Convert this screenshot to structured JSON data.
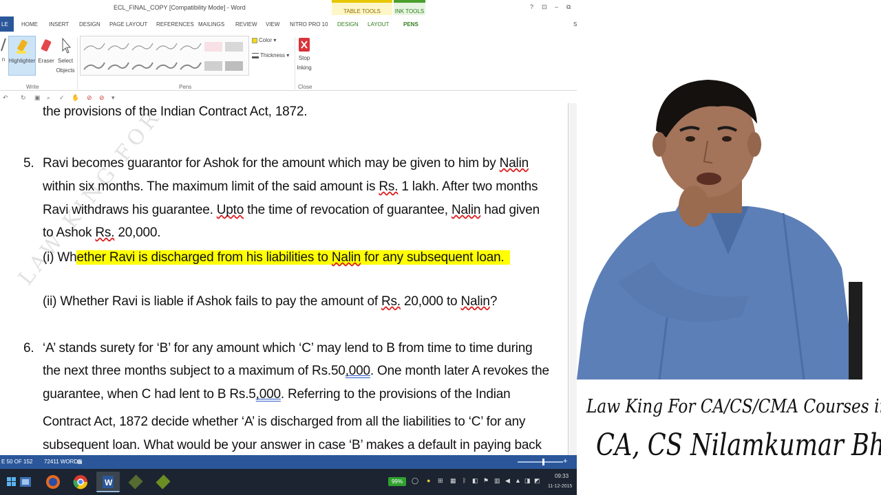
{
  "window": {
    "title": "ECL_FINAL_COPY [Compatibility Mode] - Word",
    "context_tabs": [
      "TABLE TOOLS",
      "INK TOOLS"
    ],
    "controls": [
      "?",
      "⊡",
      "–",
      "⧉"
    ]
  },
  "menu": {
    "file": "LE",
    "items": [
      "HOME",
      "INSERT",
      "DESIGN",
      "PAGE LAYOUT",
      "REFERENCES",
      "MAILINGS",
      "REVIEW",
      "VIEW",
      "NITRO PRO 10"
    ],
    "context_items": [
      "DESIGN",
      "LAYOUT",
      "PENS"
    ],
    "active": "PENS",
    "user_initial": "S"
  },
  "ribbon": {
    "write": {
      "pen_label": "n",
      "highlighter_label": "Highlighter",
      "eraser_label": "Eraser",
      "select_label_1": "Select",
      "select_label_2": "Objects",
      "group_label": "Write"
    },
    "pens": {
      "group_label": "Pens"
    },
    "color_label": "Color ▾",
    "thickness_label": "Thickness ▾",
    "close": {
      "stop_label_1": "Stop",
      "stop_label_2": "Inking",
      "group_label": "Close"
    }
  },
  "document": {
    "line_top": "the provisions of the Indian Contract Act, 1872.",
    "q5": {
      "number": "5.",
      "l1a": "Ravi becomes guarantor for Ashok for the amount which may be given to him by ",
      "l1b": "Nalin",
      "l2a": "within six months. The maximum limit of the said amount is ",
      "l2b": "Rs.",
      "l2c": " 1 lakh. After two months",
      "l3a": "Ravi withdraws his guarantee. ",
      "l3b": "Upto",
      "l3c": " the time of revocation of guarantee, ",
      "l3d": "Nalin",
      "l3e": " had given",
      "l4a": "to Ashok ",
      "l4b": "Rs.",
      "l4c": " 20,000.",
      "i_a": "(i) Wh",
      "i_b": "ether Ravi is discharged from his liabilities to ",
      "i_c": "Nalin",
      "i_d": " for any subsequent loan.",
      "ii_a": "(ii) Whether Ravi is liable if Ashok fails to pay the amount of ",
      "ii_b": "Rs.",
      "ii_c": " 20,000 to ",
      "ii_d": "Nalin",
      "ii_e": "?"
    },
    "q6": {
      "number": "6.",
      "l1": "‘A’ stands surety for ‘B’ for any amount which ‘C’ may lend to B from time to time during",
      "l2a": "the next three months subject to a maximum of Rs.50",
      "l2b": ",000",
      "l2c": ". One month later A revokes the",
      "l3a": "guarantee, when C had lent to B Rs.5",
      "l3b": ",000",
      "l3c": ". Referring to the provisions of the Indian",
      "l4": "Contract Act, 1872 decide whether ‘A’ is discharged from all the liabilities to ‘C’ for any",
      "l5": "subsequent loan. What would be your answer in case ‘B’ makes a default in paying back"
    },
    "watermark": "LAW KING FOR"
  },
  "status": {
    "page": "E 50 OF 152",
    "words": "72411 WORDS"
  },
  "taskbar": {
    "battery": "99%",
    "time": "09:33",
    "date": "11-12-2015"
  },
  "presenter": {
    "caption_line1": "Law King For CA/CS/CMA Courses in Pune",
    "caption_line2": "CA, CS Nilamkumar Bhandari"
  },
  "colors": {
    "word_blue": "#2b579a",
    "highlight": "#ffff00",
    "ink_green": "#2e7d1c",
    "table_yellow": "#e8c800"
  }
}
